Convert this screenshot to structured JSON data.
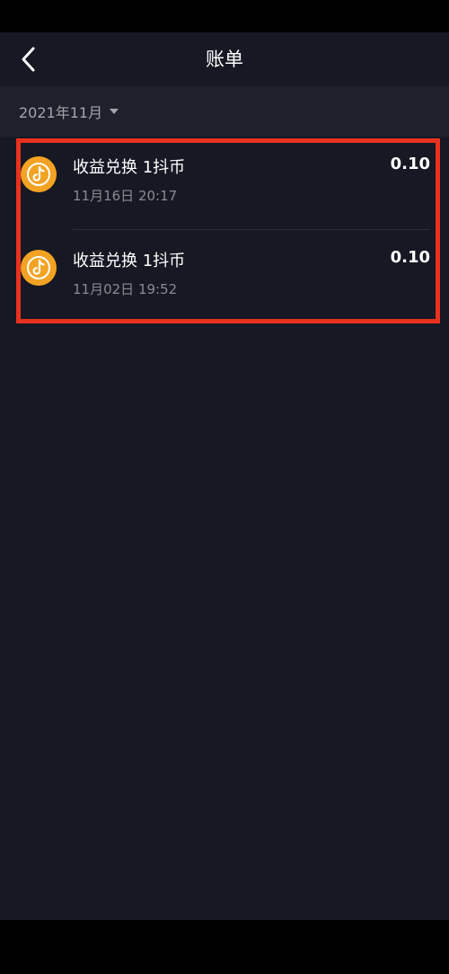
{
  "header": {
    "title": "账单",
    "back_icon": "chevron-left-icon"
  },
  "filter": {
    "month": "2021年11月",
    "dropdown_icon": "caret-down-icon"
  },
  "bills": [
    {
      "icon": "douyin-coin-icon",
      "title": "收益兑换 1抖币",
      "time": "11月16日 20:17",
      "amount": "0.10"
    },
    {
      "icon": "douyin-coin-icon",
      "title": "收益兑换 1抖币",
      "time": "11月02日 19:52",
      "amount": "0.10"
    }
  ],
  "colors": {
    "background": "#161823",
    "month_bar": "#1e202b",
    "coin": "#f3a323",
    "highlight": "#e8321f"
  }
}
